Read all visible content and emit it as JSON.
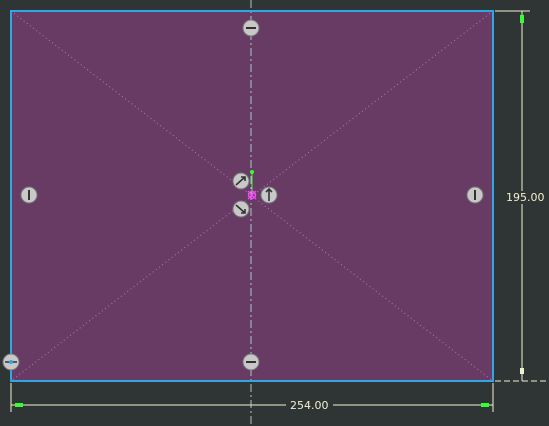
{
  "sketch": {
    "fill_color": "#683b64",
    "outline_color": "#2fa6e6",
    "construction_color": "#cc66cc",
    "centerline_color": "#a8c8c8",
    "dimension_color": "#f0f0d0",
    "handle_color": "#c8c8c8",
    "origin_color": "#ff44ff",
    "axis_tip_color": "#33ff33"
  },
  "dimensions": {
    "width_value": "254.00",
    "height_value": "195.00"
  },
  "handles": [
    {
      "name": "top-midpoint-handle",
      "icon": "horizontal-constraint-icon"
    },
    {
      "name": "bottom-midpoint-handle",
      "icon": "horizontal-constraint-icon"
    },
    {
      "name": "left-midpoint-handle",
      "icon": "vertical-constraint-icon"
    },
    {
      "name": "right-midpoint-handle",
      "icon": "vertical-constraint-icon"
    },
    {
      "name": "bottom-left-corner-handle",
      "icon": "coincident-constraint-icon"
    },
    {
      "name": "center-rotate-handle",
      "icon": "rotate-icon"
    },
    {
      "name": "center-scale-handle",
      "icon": "scale-icon"
    },
    {
      "name": "center-move-handle",
      "icon": "move-icon"
    }
  ]
}
